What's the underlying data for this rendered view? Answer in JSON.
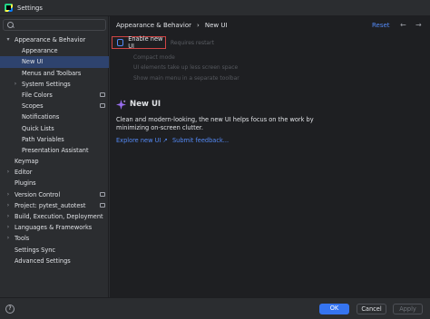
{
  "window": {
    "title": "Settings"
  },
  "sidebar": {
    "items": [
      {
        "label": "Appearance & Behavior",
        "level": 0,
        "expand": "open",
        "selected": false,
        "pref": false
      },
      {
        "label": "Appearance",
        "level": 1,
        "expand": "none",
        "selected": false,
        "pref": false
      },
      {
        "label": "New UI",
        "level": 1,
        "expand": "none",
        "selected": true,
        "pref": false
      },
      {
        "label": "Menus and Toolbars",
        "level": 1,
        "expand": "none",
        "selected": false,
        "pref": false
      },
      {
        "label": "System Settings",
        "level": 1,
        "expand": "closed",
        "selected": false,
        "pref": false
      },
      {
        "label": "File Colors",
        "level": 1,
        "expand": "none",
        "selected": false,
        "pref": true
      },
      {
        "label": "Scopes",
        "level": 1,
        "expand": "none",
        "selected": false,
        "pref": true
      },
      {
        "label": "Notifications",
        "level": 1,
        "expand": "none",
        "selected": false,
        "pref": false
      },
      {
        "label": "Quick Lists",
        "level": 1,
        "expand": "none",
        "selected": false,
        "pref": false
      },
      {
        "label": "Path Variables",
        "level": 1,
        "expand": "none",
        "selected": false,
        "pref": false
      },
      {
        "label": "Presentation Assistant",
        "level": 1,
        "expand": "none",
        "selected": false,
        "pref": false
      },
      {
        "label": "Keymap",
        "level": 0,
        "expand": "none",
        "selected": false,
        "pref": false
      },
      {
        "label": "Editor",
        "level": 0,
        "expand": "closed",
        "selected": false,
        "pref": false
      },
      {
        "label": "Plugins",
        "level": 0,
        "expand": "none",
        "selected": false,
        "pref": false
      },
      {
        "label": "Version Control",
        "level": 0,
        "expand": "closed",
        "selected": false,
        "pref": true
      },
      {
        "label": "Project: pytest_autotest",
        "level": 0,
        "expand": "closed",
        "selected": false,
        "pref": true
      },
      {
        "label": "Build, Execution, Deployment",
        "level": 0,
        "expand": "closed",
        "selected": false,
        "pref": false
      },
      {
        "label": "Languages & Frameworks",
        "level": 0,
        "expand": "closed",
        "selected": false,
        "pref": false
      },
      {
        "label": "Tools",
        "level": 0,
        "expand": "closed",
        "selected": false,
        "pref": false
      },
      {
        "label": "Settings Sync",
        "level": 0,
        "expand": "none",
        "selected": false,
        "pref": false
      },
      {
        "label": "Advanced Settings",
        "level": 0,
        "expand": "none",
        "selected": false,
        "pref": false
      }
    ]
  },
  "main": {
    "breadcrumb": [
      "Appearance & Behavior",
      "New UI"
    ],
    "breadcrumb_sep": "›",
    "reset": "Reset",
    "back_arrow": "←",
    "forward_arrow": "→",
    "enable_new_ui": {
      "label": "Enable new UI",
      "checked": false
    },
    "requires_restart": "Requires restart",
    "options": [
      "Compact mode",
      "UI elements take up less screen space",
      "Show main menu in a separate toolbar"
    ],
    "section_title": "New UI",
    "description": "Clean and modern-looking, the new UI helps focus on the work by minimizing on-screen clutter.",
    "explore_link": "Explore new UI ↗",
    "feedback_link": "Submit feedback..."
  },
  "footer": {
    "help": "?",
    "ok": "OK",
    "cancel": "Cancel",
    "apply": "Apply"
  },
  "colors": {
    "accent": "#3574f0",
    "link": "#548af7",
    "selection": "#2e436e",
    "highlight_border": "#d04545",
    "sparkle": "#9b6ef3"
  }
}
